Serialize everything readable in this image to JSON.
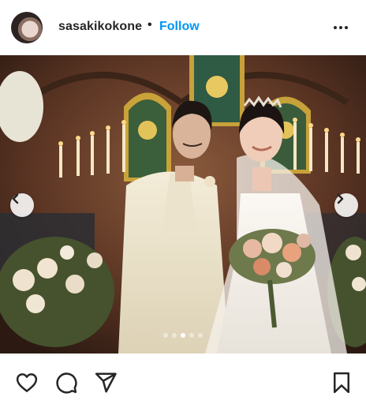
{
  "post": {
    "username": "sasakikokone",
    "separator": "•",
    "follow_label": "Follow",
    "more_icon": "more-horizontal-icon"
  },
  "carousel": {
    "slide_count": 5,
    "active_index": 2,
    "prev_icon": "chevron-left-icon",
    "next_icon": "chevron-right-icon"
  },
  "actions": {
    "like_icon": "heart-icon",
    "comment_icon": "comment-icon",
    "share_icon": "send-icon",
    "save_icon": "bookmark-icon"
  },
  "colors": {
    "link_blue": "#0095f6",
    "text_dark": "#262626"
  }
}
